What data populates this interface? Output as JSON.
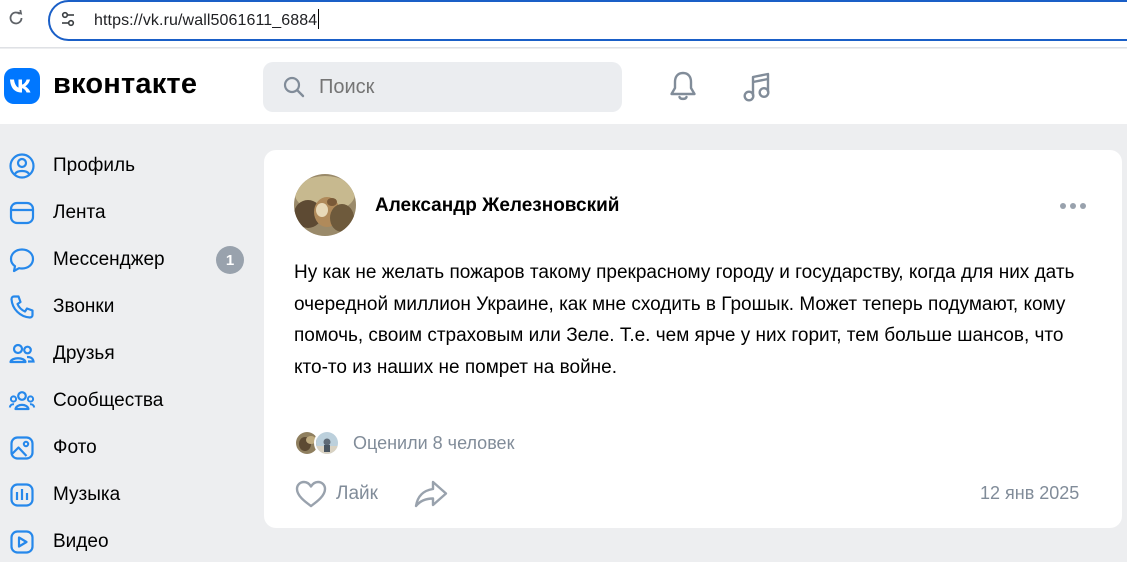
{
  "browser": {
    "url": "https://vk.ru/wall5061611_6884"
  },
  "header": {
    "logo_letters": "VK",
    "wordmark": "вконтакте",
    "search_placeholder": "Поиск",
    "icons": [
      "bell-icon",
      "music-icon"
    ]
  },
  "sidebar": {
    "items": [
      {
        "label": "Профиль",
        "icon": "profile-icon"
      },
      {
        "label": "Лента",
        "icon": "feed-icon"
      },
      {
        "label": "Мессенджер",
        "icon": "messenger-icon",
        "badge": "1"
      },
      {
        "label": "Звонки",
        "icon": "phone-icon"
      },
      {
        "label": "Друзья",
        "icon": "friends-icon"
      },
      {
        "label": "Сообщества",
        "icon": "communities-icon"
      },
      {
        "label": "Фото",
        "icon": "photo-icon"
      },
      {
        "label": "Музыка",
        "icon": "music-icon"
      },
      {
        "label": "Видео",
        "icon": "video-icon"
      }
    ]
  },
  "post": {
    "author": "Александр Железновский",
    "text": "Ну как не желать пожаров такому прекрасному городу и государству, когда для них дать очередной миллион Украине, как мне сходить в Грошык. Может теперь подумают, кому помочь, своим страховым или Зеле. Т.е. чем ярче у них горит, тем больше шансов, что кто-то из наших не помрет на войне.",
    "likes_summary": "Оценили 8 человек",
    "like_label": "Лайк",
    "date": "12 янв 2025"
  },
  "colors": {
    "accent": "#0077ff",
    "url_focus": "#1a5fc7",
    "secondary_text": "#818c99",
    "page_bg": "#edeef0"
  }
}
